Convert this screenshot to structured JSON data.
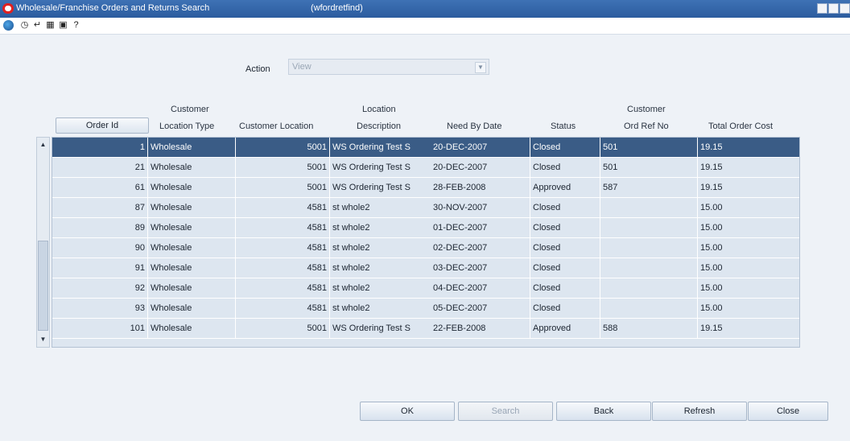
{
  "window": {
    "title": "Wholesale/Franchise Orders and Returns Search",
    "code": "(wfordretfind)"
  },
  "toolbar": {
    "icons": [
      "globe-icon",
      "help-icon",
      "spell-icon",
      "calendar-icon",
      "report-icon",
      "question-icon"
    ]
  },
  "action": {
    "label": "Action",
    "value": "View"
  },
  "columns": {
    "order_id": "Order Id",
    "cust_loc_type_1": "Customer",
    "cust_loc_type_2": "Location  Type",
    "customer_location": "Customer Location",
    "loc_desc_1": "Location",
    "loc_desc_2": "Description",
    "need_by_date": "Need By Date",
    "status": "Status",
    "cust_ord_ref_1": "Customer",
    "cust_ord_ref_2": "Ord Ref No",
    "total_order_cost": "Total Order Cost"
  },
  "rows": [
    {
      "id": "1",
      "type": "Wholesale",
      "loc": "5001",
      "desc": "WS Ordering Test S",
      "date": "20-DEC-2007",
      "status": "Closed",
      "ref": "501",
      "cost": "19.15",
      "selected": true
    },
    {
      "id": "21",
      "type": "Wholesale",
      "loc": "5001",
      "desc": "WS Ordering Test S",
      "date": "20-DEC-2007",
      "status": "Closed",
      "ref": "501",
      "cost": "19.15"
    },
    {
      "id": "61",
      "type": "Wholesale",
      "loc": "5001",
      "desc": "WS Ordering Test S",
      "date": "28-FEB-2008",
      "status": "Approved",
      "ref": "587",
      "cost": "19.15"
    },
    {
      "id": "87",
      "type": "Wholesale",
      "loc": "4581",
      "desc": "st whole2",
      "date": "30-NOV-2007",
      "status": "Closed",
      "ref": "",
      "cost": "15.00"
    },
    {
      "id": "89",
      "type": "Wholesale",
      "loc": "4581",
      "desc": "st whole2",
      "date": "01-DEC-2007",
      "status": "Closed",
      "ref": "",
      "cost": "15.00"
    },
    {
      "id": "90",
      "type": "Wholesale",
      "loc": "4581",
      "desc": "st whole2",
      "date": "02-DEC-2007",
      "status": "Closed",
      "ref": "",
      "cost": "15.00"
    },
    {
      "id": "91",
      "type": "Wholesale",
      "loc": "4581",
      "desc": "st whole2",
      "date": "03-DEC-2007",
      "status": "Closed",
      "ref": "",
      "cost": "15.00"
    },
    {
      "id": "92",
      "type": "Wholesale",
      "loc": "4581",
      "desc": "st whole2",
      "date": "04-DEC-2007",
      "status": "Closed",
      "ref": "",
      "cost": "15.00"
    },
    {
      "id": "93",
      "type": "Wholesale",
      "loc": "4581",
      "desc": "st whole2",
      "date": "05-DEC-2007",
      "status": "Closed",
      "ref": "",
      "cost": "15.00"
    },
    {
      "id": "101",
      "type": "Wholesale",
      "loc": "5001",
      "desc": "WS Ordering Test S",
      "date": "22-FEB-2008",
      "status": "Approved",
      "ref": "588",
      "cost": "19.15"
    }
  ],
  "buttons": {
    "ok": "OK",
    "search": "Search",
    "back": "Back",
    "refresh": "Refresh",
    "close": "Close"
  }
}
